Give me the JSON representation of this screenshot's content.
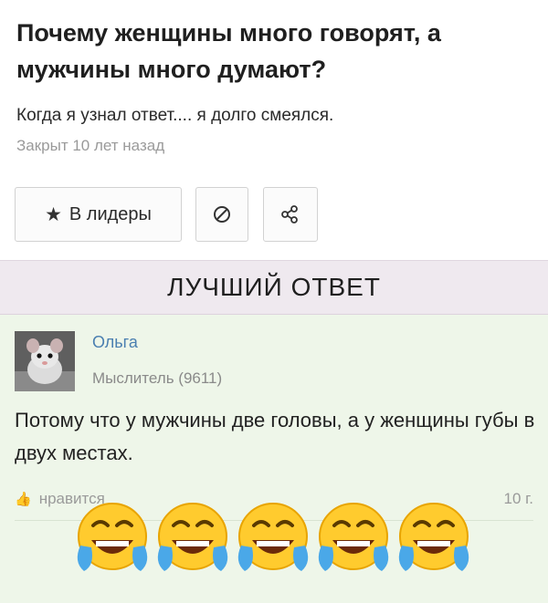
{
  "question": {
    "title": "Почему женщины много говорят, а мужчины много думают?",
    "subtitle": "Когда я узнал ответ.... я долго смеялся.",
    "meta": "Закрыт 10 лет назад"
  },
  "actions": {
    "leaders_label": "В лидеры",
    "star_icon": "star-icon",
    "block_icon": "block-icon",
    "share_icon": "share-icon"
  },
  "best_answer": {
    "header": "ЛУЧШИЙ ОТВЕТ",
    "author": "Ольга",
    "rank": "Мыслитель (9611)",
    "text": "Потому что у мужчины две головы, а у женщины губы в двух местах.",
    "like_label": "нравится",
    "time": "10 г."
  },
  "reactions": {
    "emoji": "face-with-tears-of-joy",
    "count": 5
  },
  "colors": {
    "link": "#4a7fb0",
    "muted": "#9a9a9a",
    "best_header_bg": "#efe9ef",
    "answer_bg": "#eef6e9"
  }
}
